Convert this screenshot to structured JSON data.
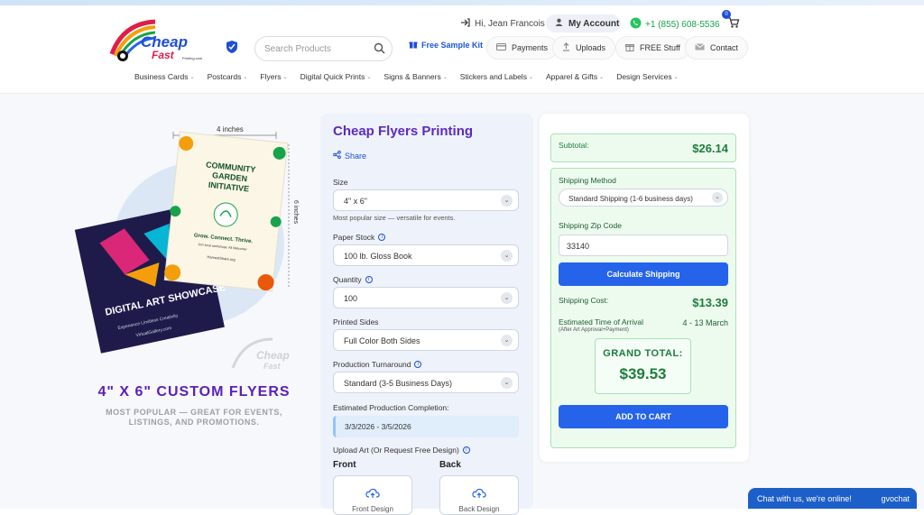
{
  "header": {
    "greeting": "Hi, Jean Francois",
    "my_account": "My Account",
    "phone": "+1 (855) 608-5536",
    "cart_count": "0",
    "search_placeholder": "Search Products",
    "free_sample_kit": "Free Sample Kit",
    "utility_links": [
      {
        "label": "Payments",
        "icon": "card-icon"
      },
      {
        "label": "Uploads",
        "icon": "upload-icon"
      },
      {
        "label": "FREE Stuff",
        "icon": "gift-icon"
      },
      {
        "label": "Contact",
        "icon": "mail-icon"
      }
    ],
    "logo_text_1": "Cheap",
    "logo_text_2": "Fast",
    "logo_text_3": "Printing.com"
  },
  "nav": [
    "Business Cards",
    "Postcards",
    "Flyers",
    "Digital Quick Prints",
    "Signs & Banners",
    "Stickers and Labels",
    "Apparel & Gifts",
    "Design Services"
  ],
  "hero": {
    "dim_width": "4 inches",
    "dim_height": "6 inches",
    "card_back_title": "DIGITAL ART SHOWCASE",
    "card_back_sub": "Experience Limitless Creativity",
    "card_back_url": "VirtualGallery.com",
    "card_front_title": "COMMUNITY GARDEN INITIATIVE",
    "card_front_tag": "Grow. Connect. Thrive.",
    "card_front_sub": "Join local workshops. All Welcome!",
    "card_front_url": "HarvestShare.org",
    "title": "4\" X 6\" CUSTOM FLYERS",
    "subtitle": "MOST POPULAR — GREAT FOR EVENTS, LISTINGS, AND PROMOTIONS.",
    "watermark_1": "Cheap",
    "watermark_2": "Fast"
  },
  "form": {
    "title": "Cheap Flyers Printing",
    "share": "Share",
    "size_label": "Size",
    "size_value": "4\" x 6\"",
    "size_hint": "Most popular size — versatile for events.",
    "paper_label": "Paper Stock",
    "paper_value": "100 lb. Gloss Book",
    "qty_label": "Quantity",
    "qty_value": "100",
    "sides_label": "Printed Sides",
    "sides_value": "Full Color Both Sides",
    "turnaround_label": "Production Turnaround",
    "turnaround_value": "Standard (3-5 Business Days)",
    "est_label": "Estimated Production Completion:",
    "est_value": "3/3/2026 - 3/5/2026",
    "upload_label": "Upload Art (Or Request Free Design)",
    "front_label": "Front",
    "back_label": "Back",
    "front_design": "Front Design",
    "back_design": "Back Design"
  },
  "summary": {
    "subtotal_label": "Subtotal:",
    "subtotal_value": "$26.14",
    "ship_method_label": "Shipping Method",
    "ship_method_value": "Standard Shipping (1-6 business days)",
    "zip_label": "Shipping Zip Code",
    "zip_value": "33140",
    "calc_button": "Calculate Shipping",
    "ship_cost_label": "Shipping Cost:",
    "ship_cost_value": "$13.39",
    "eta_label": "Estimated Time of Arrival",
    "eta_value": "4 - 13 March",
    "eta_sub": "(After Art Approval+Payment)",
    "grand_label": "GRAND TOTAL:",
    "grand_value": "$39.53",
    "add_to_cart": "ADD TO CART"
  },
  "chat": {
    "text": "Chat with us, we're online!",
    "brand": "gvochat"
  },
  "colors": {
    "accent_blue": "#2563eb",
    "title_purple": "#5b2bbf",
    "green": "#1e7d3b",
    "green_bg": "#edfbef"
  }
}
